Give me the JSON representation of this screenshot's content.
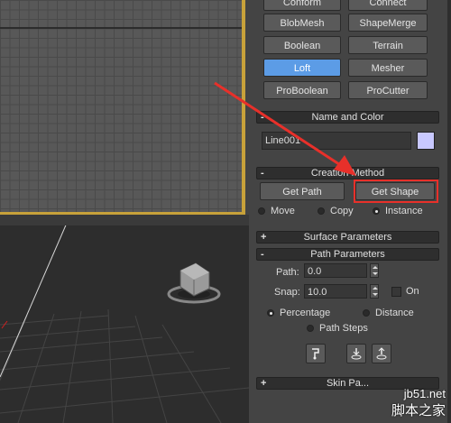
{
  "viewport_top": {
    "name": "top-viewport"
  },
  "compound_buttons": [
    {
      "label": "Conform"
    },
    {
      "label": "Connect"
    },
    {
      "label": "BlobMesh"
    },
    {
      "label": "ShapeMerge"
    },
    {
      "label": "Boolean"
    },
    {
      "label": "Terrain"
    },
    {
      "label": "Loft",
      "active": true
    },
    {
      "label": "Mesher"
    },
    {
      "label": "ProBoolean"
    },
    {
      "label": "ProCutter"
    }
  ],
  "name_and_color": {
    "title": "Name and Color",
    "name_value": "Line001",
    "swatch_color": "#c8c8ff"
  },
  "creation_method": {
    "title": "Creation Method",
    "get_path": "Get Path",
    "get_shape": "Get Shape",
    "options": [
      "Move",
      "Copy",
      "Instance"
    ],
    "selected": "Instance"
  },
  "surface_parameters": {
    "title": "Surface Parameters",
    "toggle": "+"
  },
  "path_parameters": {
    "title": "Path Parameters",
    "toggle": "-",
    "path_label": "Path:",
    "path_value": "0.0",
    "snap_label": "Snap:",
    "snap_value": "10.0",
    "on_label": "On",
    "options": [
      "Percentage",
      "Distance",
      "Path Steps"
    ],
    "selected": "Percentage"
  },
  "skin_parameters": {
    "title": "Skin Pa...",
    "toggle": "+"
  },
  "rollout_toggle_minus": "-",
  "watermark": {
    "line1": "jb51.net",
    "line2": "脚本之家"
  },
  "colors": {
    "accent": "#5c9ce6",
    "highlight": "#e8302a",
    "viewport_border": "#c8a23a"
  }
}
